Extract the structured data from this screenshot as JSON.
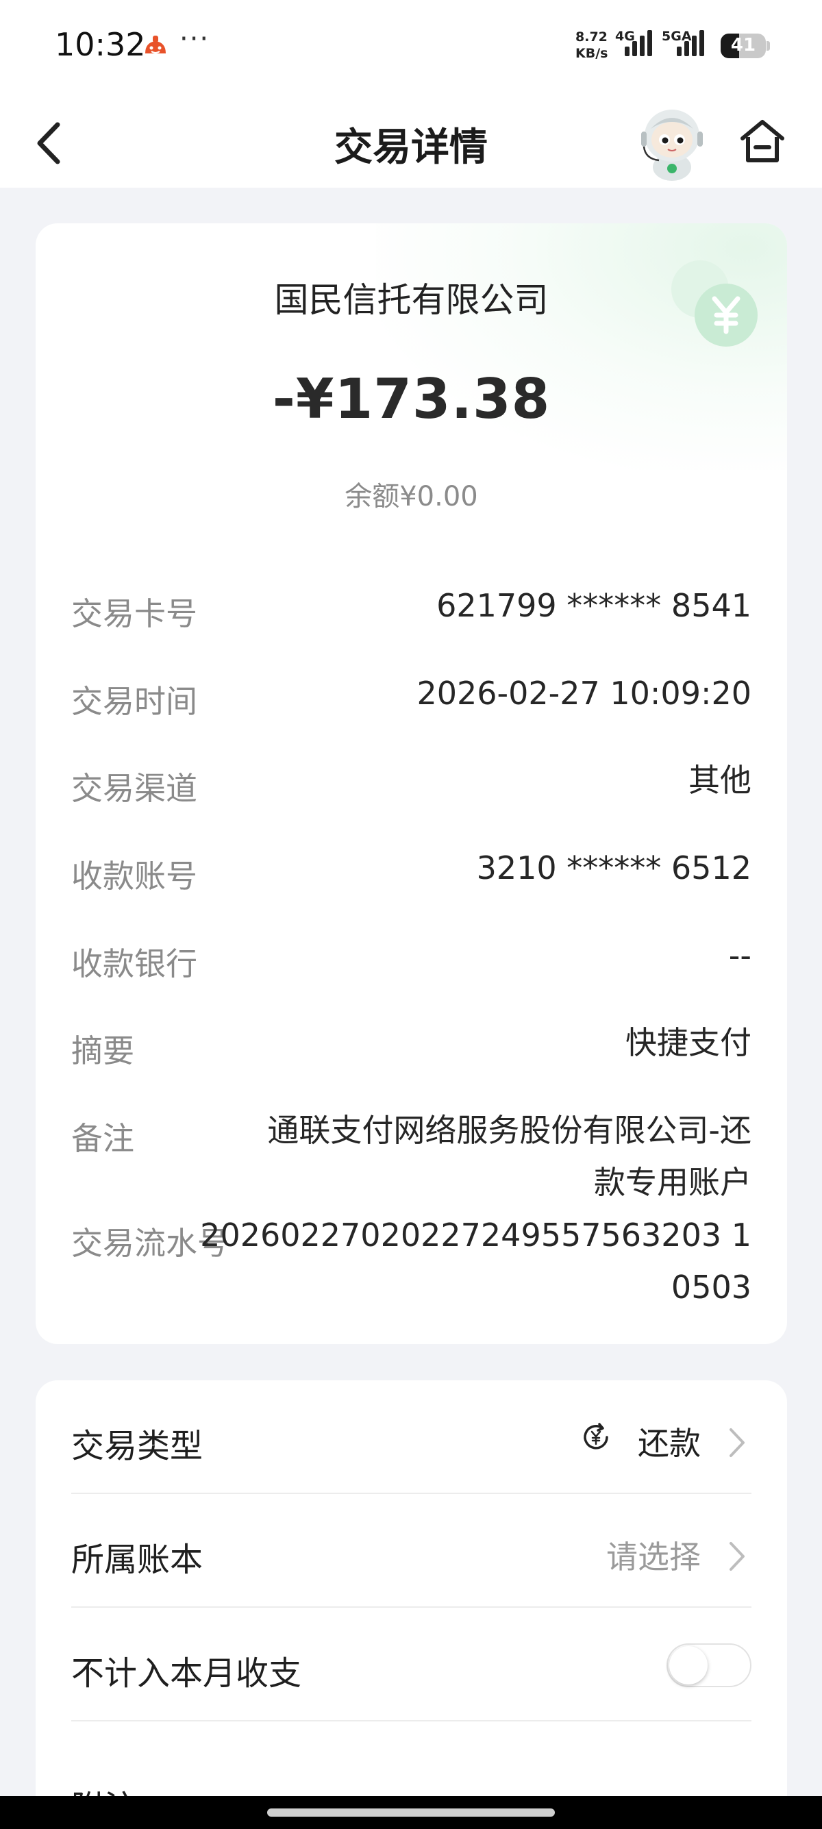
{
  "status_bar": {
    "time": "10:32",
    "net_speed_top": "8.72",
    "net_speed_unit": "KB/s",
    "net_type_1": "4G",
    "net_type_2": "5GA",
    "battery": "41",
    "more": "···"
  },
  "header": {
    "title": "交易详情"
  },
  "summary": {
    "merchant": "国民信托有限公司",
    "amount": "-¥173.38",
    "balance": "余额¥0.00"
  },
  "details": [
    {
      "label": "交易卡号",
      "value": "621799 ****** 8541"
    },
    {
      "label": "交易时间",
      "value": "2026-02-27 10:09:20"
    },
    {
      "label": "交易渠道",
      "value": "其他"
    },
    {
      "label": "收款账号",
      "value": "3210 ****** 6512"
    },
    {
      "label": "收款银行",
      "value": "--"
    },
    {
      "label": "摘要",
      "value": "快捷支付"
    },
    {
      "label": "备注",
      "value_line1": "通联支付网络服务股份有限公司-还",
      "value_line2": "款专用账户"
    },
    {
      "label": "交易流水号",
      "value_line1": "20260227020227249557563203 1",
      "value_line2": "0503"
    }
  ],
  "settings": {
    "type_label": "交易类型",
    "type_value": "还款",
    "book_label": "所属账本",
    "book_placeholder": "请选择",
    "exclude_label": "不计入本月收支",
    "exclude_on": false,
    "attachment_label": "附注"
  },
  "colors": {
    "accent_green": "#7fd39a",
    "page_bg": "#f2f3f7"
  }
}
